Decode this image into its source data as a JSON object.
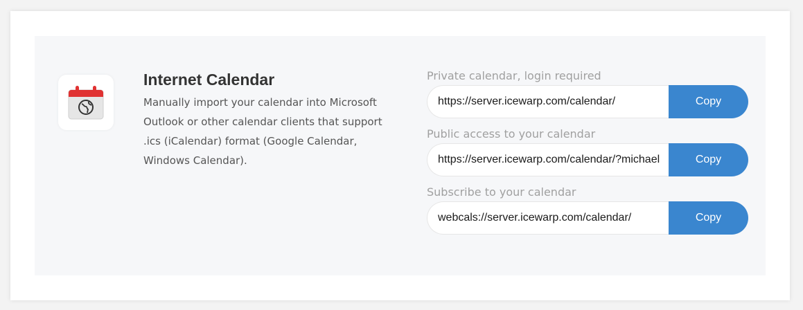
{
  "colors": {
    "accent": "#3a86cf",
    "icon_red": "#e03232",
    "panel_bg": "#f6f7f9"
  },
  "icon": {
    "name": "calendar-globe-icon"
  },
  "info": {
    "title": "Internet Calendar",
    "description": "Manually import your calendar into Microsoft Outlook or other calendar clients that support .ics (iCalendar) format (Google Calendar, Windows Calendar)."
  },
  "links": [
    {
      "label": "Private calendar, login required",
      "value": "https://server.icewarp.com/calendar/",
      "button": "Copy"
    },
    {
      "label": "Public access to your calendar",
      "value": "https://server.icewarp.com/calendar/?michael",
      "button": "Copy"
    },
    {
      "label": "Subscribe to your calendar",
      "value": "webcals://server.icewarp.com/calendar/",
      "button": "Copy"
    }
  ]
}
